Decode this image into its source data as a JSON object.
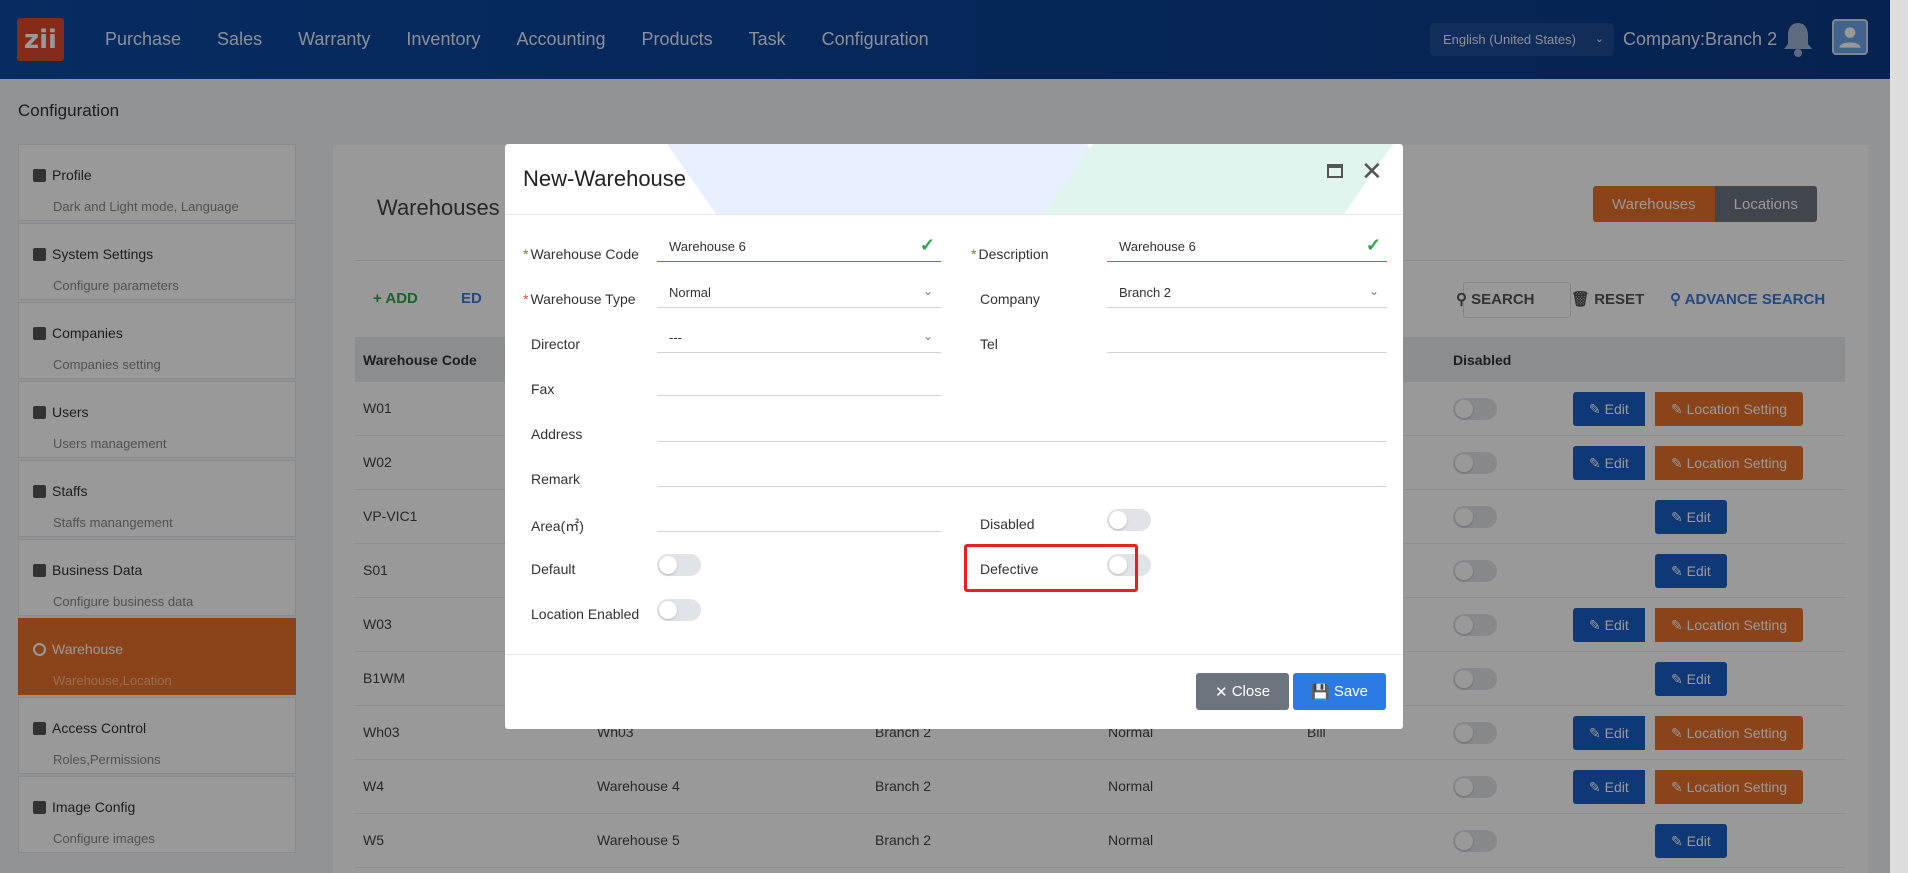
{
  "nav": {
    "logo": "zii",
    "menu": [
      "Purchase",
      "Sales",
      "Warranty",
      "Inventory",
      "Accounting",
      "Products",
      "Task",
      "Configuration"
    ],
    "language": "English (United States)",
    "company": "Company:Branch 2"
  },
  "page": {
    "title": "Configuration"
  },
  "sidebar": {
    "items": [
      {
        "title": "Profile",
        "sub": "Dark and Light mode, Language"
      },
      {
        "title": "System Settings",
        "sub": "Configure parameters"
      },
      {
        "title": "Companies",
        "sub": "Companies setting"
      },
      {
        "title": "Users",
        "sub": "Users management"
      },
      {
        "title": "Staffs",
        "sub": "Staffs manangement"
      },
      {
        "title": "Business Data",
        "sub": "Configure business data"
      },
      {
        "title": "Warehouse",
        "sub": "Warehouse,Location"
      },
      {
        "title": "Access Control",
        "sub": "Roles,Permissions"
      },
      {
        "title": "Image Config",
        "sub": "Configure images"
      }
    ]
  },
  "main": {
    "title": "Warehouses",
    "tabs": [
      "Warehouses",
      "Locations"
    ],
    "toolbar": {
      "add": "+ ADD",
      "edit": "ED",
      "search": "SEARCH",
      "reset": "RESET",
      "advance": "ADVANCE SEARCH"
    },
    "columns": {
      "code": "Warehouse Code",
      "disabled": "Disabled"
    },
    "rows": [
      {
        "code": "W01",
        "desc": "",
        "company": "",
        "type": "",
        "director": "",
        "loc": true
      },
      {
        "code": "W02",
        "desc": "",
        "company": "",
        "type": "",
        "director": "",
        "loc": true
      },
      {
        "code": "VP-VIC1",
        "desc": "",
        "company": "",
        "type": "",
        "director": "",
        "loc": false
      },
      {
        "code": "S01",
        "desc": "",
        "company": "",
        "type": "",
        "director": "",
        "loc": false
      },
      {
        "code": "W03",
        "desc": "",
        "company": "",
        "type": "",
        "director": "",
        "loc": true
      },
      {
        "code": "B1WM",
        "desc": "",
        "company": "",
        "type": "",
        "director": "",
        "loc": false
      },
      {
        "code": "Wh03",
        "desc": "Wh03",
        "company": "Branch 2",
        "type": "Normal",
        "director": "Bill",
        "loc": true
      },
      {
        "code": "W4",
        "desc": "Warehouse 4",
        "company": "Branch 2",
        "type": "Normal",
        "director": "",
        "loc": true
      },
      {
        "code": "W5",
        "desc": "Warehouse 5",
        "company": "Branch 2",
        "type": "Normal",
        "director": "",
        "loc": false
      }
    ],
    "edit_label": "Edit",
    "loc_label": "Location Setting"
  },
  "modal": {
    "title": "New-Warehouse",
    "fields": {
      "code_label": "Warehouse Code",
      "code_value": "Warehouse 6",
      "desc_label": "Description",
      "desc_value": "Warehouse 6",
      "type_label": "Warehouse Type",
      "type_value": "Normal",
      "company_label": "Company",
      "company_value": "Branch 2",
      "director_label": "Director",
      "director_value": "---",
      "tel_label": "Tel",
      "fax_label": "Fax",
      "address_label": "Address",
      "remark_label": "Remark",
      "area_label": "Area(㎡)",
      "disabled_label": "Disabled",
      "default_label": "Default",
      "defective_label": "Defective",
      "location_label": "Location Enabled"
    },
    "close": "Close",
    "save": "Save"
  }
}
